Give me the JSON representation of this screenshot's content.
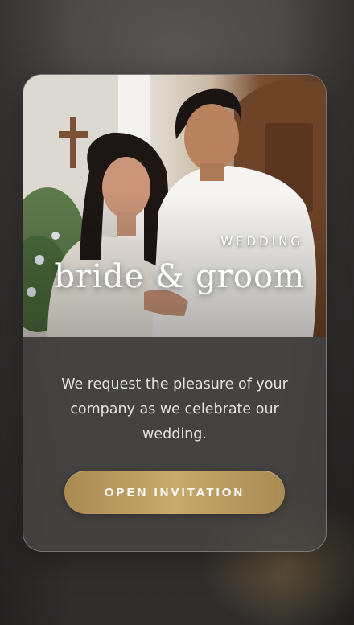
{
  "hero": {
    "eyebrow": "WEDDING",
    "names": "bride & groom"
  },
  "invitation": {
    "message": "We request the pleasure of your company as we celebrate our wedding.",
    "open_button_label": "OPEN INVITATION"
  },
  "colors": {
    "accent_gold": "#c3a466",
    "card_background": "#484644",
    "text_light": "#e7e3df"
  },
  "icons": {
    "cross": "cross-icon"
  }
}
